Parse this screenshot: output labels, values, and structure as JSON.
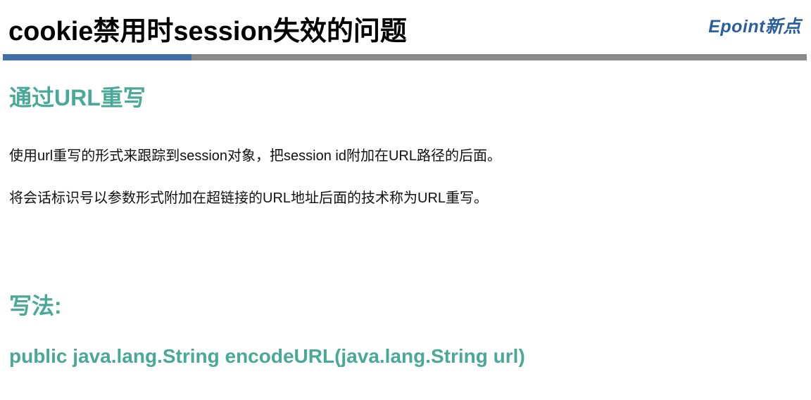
{
  "header": {
    "title": "cookie禁用时session失效的问题",
    "logo_text": "Epoint新点",
    "colors": {
      "logo": "#2a5f9e",
      "rule_accent": "#3f6fa5",
      "rule_rest": "#8a8a8a"
    }
  },
  "content": {
    "section1": {
      "heading": "通过URL重写",
      "paragraphs": [
        "使用url重写的形式来跟踪到session对象，把session id附加在URL路径的后面。",
        "将会话标识号以参数形式附加在超链接的URL地址后面的技术称为URL重写。"
      ]
    },
    "section2": {
      "heading": "写法:",
      "code": "public java.lang.String encodeURL(java.lang.String url)"
    },
    "colors": {
      "accent_green": "#4aa896",
      "body_text": "#111111"
    }
  }
}
